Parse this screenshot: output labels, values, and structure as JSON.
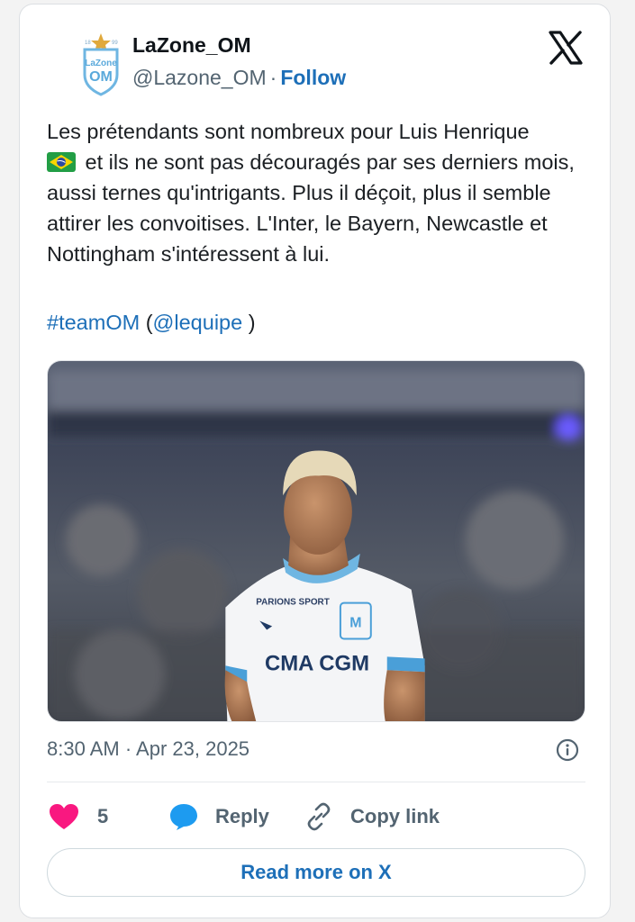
{
  "tweet": {
    "display_name": "LaZone_OM",
    "handle": "@Lazone_OM",
    "separator": "·",
    "follow_label": "Follow",
    "avatar_text": "LaZone OM",
    "avatar_year_left": "18",
    "avatar_year_right": "99",
    "body_line_1": "Les prétendants sont nombreux pour Luis Henrique",
    "body_rest": " et ils ne sont pas découragés par ses derniers mois, aussi ternes qu'intrigants. Plus il déçoit, plus il semble attirer les convoitises. L'Inter, le Bayern, Newcastle et Nottingham s'intéressent à lui.",
    "hashtag": "#teamOM",
    "paren_open": " (",
    "mention": "@lequipe",
    "paren_close": " )",
    "timestamp": "8:30 AM · Apr 23, 2025",
    "likes_count": "5",
    "reply_label": "Reply",
    "copy_link_label": "Copy link",
    "read_more_label": "Read more on X"
  },
  "photo": {
    "shirt_sponsor": "CMA CGM",
    "shirt_sleeve_sponsor": "PARIONS SPORT"
  },
  "icons": {
    "logo": "x-logo-icon",
    "flag": "brazil-flag-icon",
    "info": "info-icon",
    "like": "heart-icon",
    "reply": "speech-bubble-icon",
    "copy": "link-icon"
  },
  "colors": {
    "link_blue": "#1d6fb8",
    "heart": "#f91880",
    "reply_bubble": "#1d9bf0",
    "muted": "#536471"
  }
}
